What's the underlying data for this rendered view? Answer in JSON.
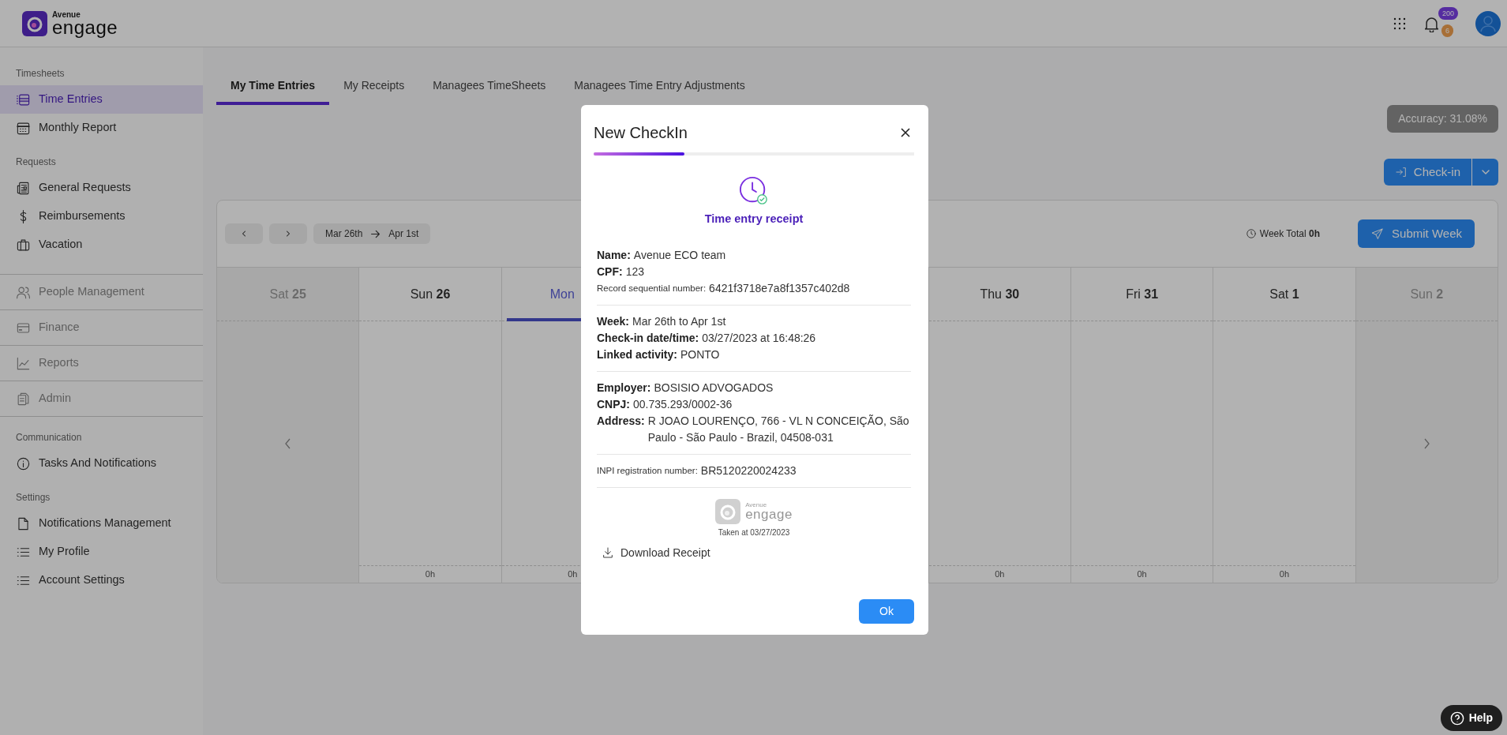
{
  "header": {
    "logo": {
      "brand": "Avenue",
      "product": "engage"
    },
    "notifications": [
      {
        "count": "200"
      },
      {
        "count": "6"
      }
    ]
  },
  "sidebar": [
    {
      "kind": "section",
      "title": "Timesheets",
      "items": [
        {
          "label": "Time Entries",
          "selected": true
        },
        {
          "label": "Monthly Report",
          "selected": false
        }
      ]
    },
    {
      "kind": "section",
      "title": "Requests",
      "items": [
        {
          "label": "General Requests",
          "selected": false
        },
        {
          "label": "Reimbursements",
          "selected": false
        },
        {
          "label": "Vacation",
          "selected": false
        }
      ]
    },
    {
      "kind": "group",
      "label": "People Management"
    },
    {
      "kind": "group",
      "label": "Finance"
    },
    {
      "kind": "group",
      "label": "Reports"
    },
    {
      "kind": "group",
      "label": "Admin"
    },
    {
      "kind": "section",
      "title": "Communication",
      "items": [
        {
          "label": "Tasks And Notifications",
          "selected": false
        }
      ]
    },
    {
      "kind": "section",
      "title": "Settings",
      "items": [
        {
          "label": "Notifications Management",
          "selected": false
        },
        {
          "label": "My Profile",
          "selected": false
        },
        {
          "label": "Account Settings",
          "selected": false
        }
      ]
    }
  ],
  "tabs": [
    {
      "label": "My Time Entries",
      "selected": true
    },
    {
      "label": "My Receipts",
      "selected": false
    },
    {
      "label": "Managees TimeSheets",
      "selected": false
    },
    {
      "label": "Managees Time Entry Adjustments",
      "selected": false
    }
  ],
  "accuracy": "Accuracy: 31.08%",
  "checkin_button": "Check-in",
  "calendar": {
    "range_start": "Mar 26th",
    "range_end": "Apr 1st",
    "week_total": "Week Total **0h**",
    "submit": "Submit Week",
    "days": [
      {
        "weekday": "Sat",
        "day": "25",
        "in_week": false,
        "selected": false
      },
      {
        "weekday": "Sun",
        "day": "26",
        "in_week": true,
        "selected": false,
        "total": "0h"
      },
      {
        "weekday": "Mon",
        "in_week": true,
        "selected": true,
        "total": "0h"
      }
    ],
    "more_days": [
      {
        "weekday": "Thu",
        "day": "30",
        "in_week": true,
        "selected": false,
        "total": "0h"
      },
      {
        "weekday": "Fri",
        "day": "31",
        "in_week": true,
        "selected": false,
        "total": "0h"
      },
      {
        "weekday": "Sat",
        "day": "1",
        "in_week": true,
        "selected": false,
        "total": "0h"
      },
      {
        "weekday": "Sun",
        "day": "2",
        "in_week": false,
        "selected": false
      }
    ]
  },
  "modal": {
    "title": "New CheckIn",
    "subtitle": "Time entry receipt",
    "sections": [
      [
        {
          "kind": "normal",
          "label": "Name:",
          "value": "Avenue ECO team"
        },
        {
          "kind": "normal",
          "label": "CPF:",
          "value": "123"
        },
        {
          "kind": "small",
          "label": "Record sequential number:",
          "value": "6421f3718e7a8f1357c402d8"
        }
      ],
      [
        {
          "kind": "normal",
          "label": "Week:",
          "value": "Mar 26th to Apr 1st"
        },
        {
          "kind": "normal",
          "label": "Check-in date/time:",
          "value": "03/27/2023 at 16:48:26"
        },
        {
          "kind": "normal",
          "label": "Linked activity:",
          "value": "PONTO"
        }
      ],
      [
        {
          "kind": "normal",
          "label": "Employer:",
          "value": "BOSISIO ADVOGADOS"
        },
        {
          "kind": "normal",
          "label": "CNPJ:",
          "value": "00.735.293/0002-36"
        },
        {
          "kind": "normal",
          "label": "Address:",
          "value": "R JOAO LOURENÇO, 766 - VL N CONCEIÇÃO, São Paulo - São Paulo - Brazil, 04508-031"
        }
      ],
      [
        {
          "kind": "small",
          "label": "INPI registration number:",
          "value": "BR5120220024233"
        }
      ]
    ],
    "logo": {
      "brand": "Avenue",
      "product": "engage"
    },
    "taken_at": "Taken at 03/27/2023",
    "download": "Download Receipt",
    "ok": "Ok"
  },
  "help": "Help"
}
